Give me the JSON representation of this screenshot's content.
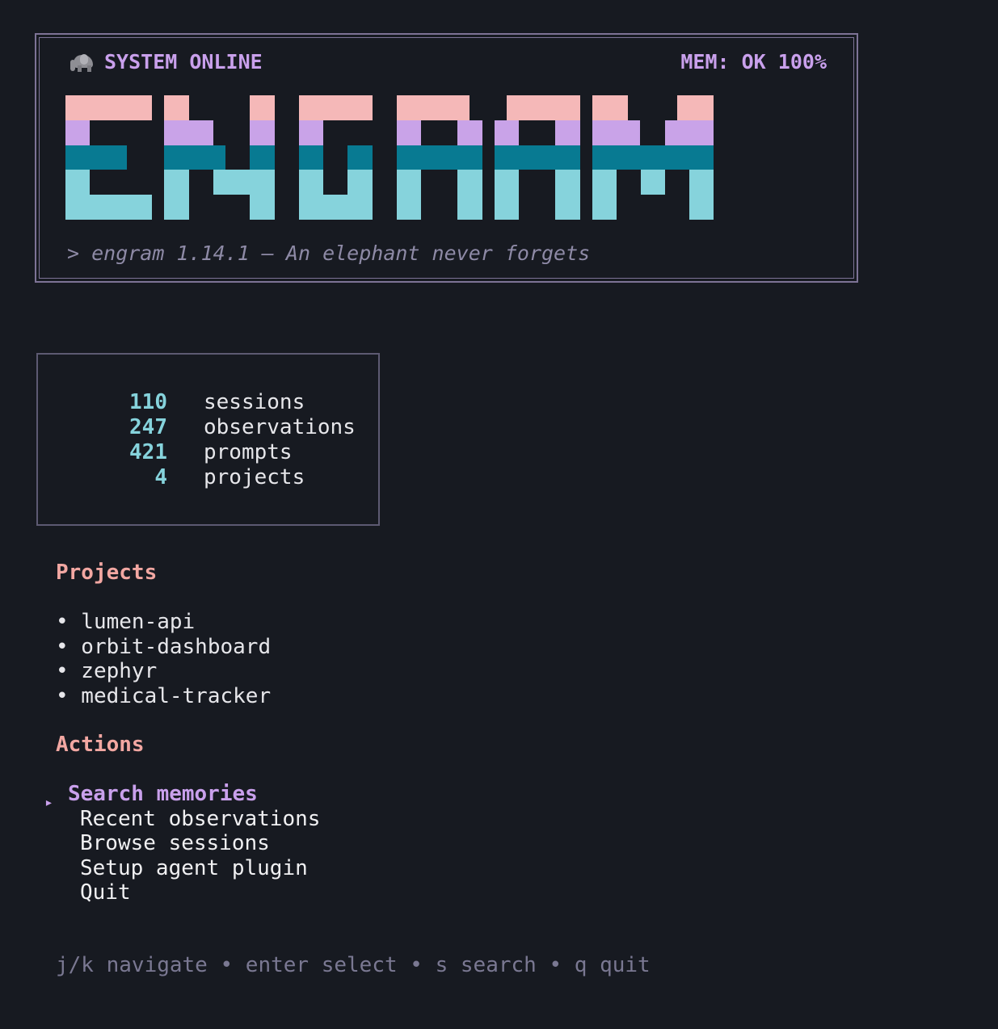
{
  "header": {
    "status_text": "SYSTEM ONLINE",
    "memory_text": "MEM: OK 100%",
    "logo_text": "ENGRAM",
    "tagline": "> engram 1.14.1 — An elephant never forgets",
    "icon": "elephant-icon"
  },
  "stats": [
    {
      "value": "110",
      "label": "sessions"
    },
    {
      "value": "247",
      "label": "observations"
    },
    {
      "value": "421",
      "label": "prompts"
    },
    {
      "value": "4",
      "label": "projects"
    }
  ],
  "projects": {
    "heading": "Projects",
    "items": [
      "• lumen-api",
      "• orbit-dashboard",
      "• zephyr",
      "• medical-tracker"
    ]
  },
  "actions": {
    "heading": "Actions",
    "pointer": "▸",
    "items": [
      "Search memories",
      "Recent observations",
      "Browse sessions",
      "Setup agent plugin",
      "Quit"
    ],
    "selected_index": 0
  },
  "help": "j/k navigate • enter select • s search • q quit",
  "colors": {
    "background": "#171a21",
    "logo_band_1": "#f5b8b8",
    "logo_band_2": "#c9a3e8",
    "logo_band_3": "#087a92",
    "logo_band_4": "#86d3dc",
    "accent": "#c9a0ec",
    "heading": "#f2a7a2",
    "number": "#86d3dc"
  }
}
